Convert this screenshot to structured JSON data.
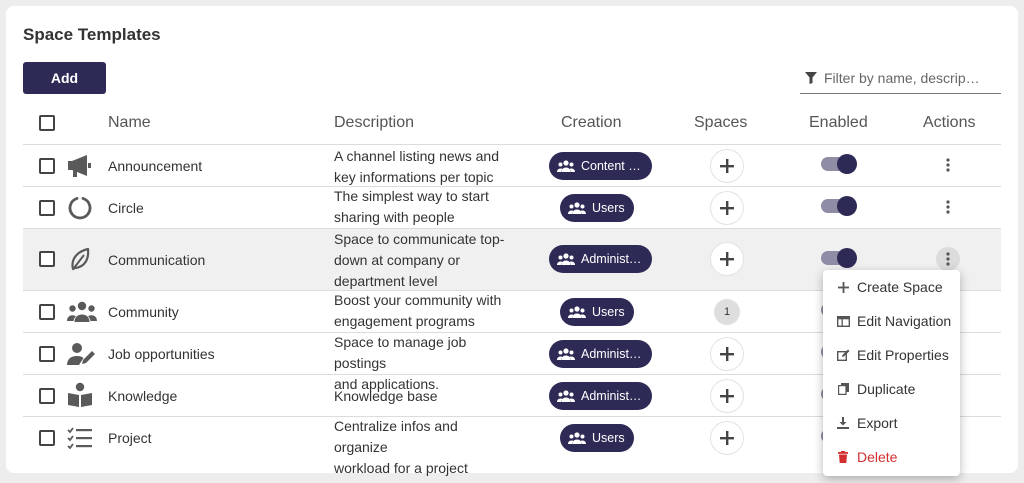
{
  "title": "Space Templates",
  "add_label": "Add",
  "filter": {
    "placeholder": "Filter by name, descrip…"
  },
  "columns": {
    "name": "Name",
    "description": "Description",
    "creation": "Creation",
    "spaces": "Spaces",
    "enabled": "Enabled",
    "actions": "Actions"
  },
  "rows": [
    {
      "name": "Announcement",
      "icon": "megaphone-icon",
      "desc1": "A channel listing news and",
      "desc2": "key informations per topic",
      "desc3": "",
      "creation": "Content …",
      "spaces": "",
      "enabled": true
    },
    {
      "name": "Circle",
      "icon": "circle-icon",
      "desc1": "The simplest way to start",
      "desc2": "sharing with people",
      "desc3": "",
      "creation": "Users",
      "spaces": "",
      "enabled": true
    },
    {
      "name": "Communication",
      "icon": "leaf-icon",
      "desc1": "Space to communicate top-",
      "desc2": "down at company or",
      "desc3": "department level",
      "creation": "Administ…",
      "spaces": "",
      "enabled": true
    },
    {
      "name": "Community",
      "icon": "users-icon",
      "desc1": "Boost your community with",
      "desc2": "engagement programs",
      "desc3": "",
      "creation": "Users",
      "spaces": "1",
      "enabled": true
    },
    {
      "name": "Job opportunities",
      "icon": "user-edit-icon",
      "desc1": "Space to manage job postings",
      "desc2": "and applications.",
      "desc3": "",
      "creation": "Administ…",
      "spaces": "",
      "enabled": true
    },
    {
      "name": "Knowledge",
      "icon": "book-reader-icon",
      "desc1": "Knowledge base",
      "desc2": "",
      "desc3": "",
      "creation": "Administ…",
      "spaces": "",
      "enabled": true
    },
    {
      "name": "Project",
      "icon": "task-list-icon",
      "desc1": "Centralize infos and organize",
      "desc2": "workload for a project",
      "desc3": "",
      "creation": "Users",
      "spaces": "",
      "enabled": true
    }
  ],
  "menu": {
    "create_space": "Create Space",
    "edit_navigation": "Edit Navigation",
    "edit_properties": "Edit Properties",
    "duplicate": "Duplicate",
    "export": "Export",
    "delete": "Delete"
  },
  "colors": {
    "primary": "#2e2a56",
    "toggle_track": "#8f8ca5",
    "delete": "#d32f2f"
  }
}
